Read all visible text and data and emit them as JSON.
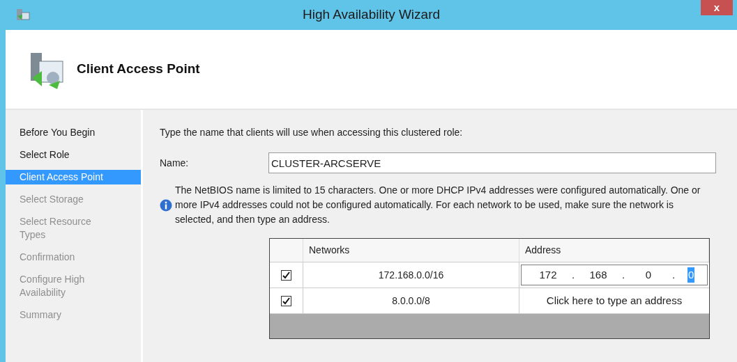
{
  "window": {
    "title": "High Availability Wizard",
    "close": "x"
  },
  "header": {
    "title": "Client Access Point"
  },
  "steps": [
    {
      "label": "Before You Begin",
      "selected": false,
      "disabled": false
    },
    {
      "label": "Select Role",
      "selected": false,
      "disabled": false
    },
    {
      "label": "Client Access Point",
      "selected": true,
      "disabled": false
    },
    {
      "label": "Select Storage",
      "selected": false,
      "disabled": true
    },
    {
      "label": "Select Resource Types",
      "selected": false,
      "disabled": true
    },
    {
      "label": "Confirmation",
      "selected": false,
      "disabled": true
    },
    {
      "label": "Configure High Availability",
      "selected": false,
      "disabled": true
    },
    {
      "label": "Summary",
      "selected": false,
      "disabled": true
    }
  ],
  "intro": "Type the name that clients will use when accessing this clustered role:",
  "name_field": {
    "label": "Name:",
    "value": "CLUSTER-ARCSERVE"
  },
  "info": "The NetBIOS name is limited to 15 characters.  One or more DHCP IPv4 addresses were configured automatically.  One or more IPv4 addresses could not be configured automatically.  For each network to be used, make sure the network is selected, and then type an address.",
  "table": {
    "columns": [
      "Networks",
      "Address"
    ],
    "rows": [
      {
        "checked": true,
        "network": "172.168.0.0/16",
        "address": {
          "kind": "ip",
          "separator": ".",
          "octets": [
            {
              "text": "172",
              "selected": false
            },
            {
              "text": "168",
              "selected": false
            },
            {
              "text": "0",
              "selected": false
            },
            {
              "text": "0",
              "selected": true
            }
          ]
        }
      },
      {
        "checked": true,
        "network": "8.0.0.0/8",
        "address": {
          "kind": "prompt",
          "text": "Click here to type an address"
        }
      }
    ]
  }
}
